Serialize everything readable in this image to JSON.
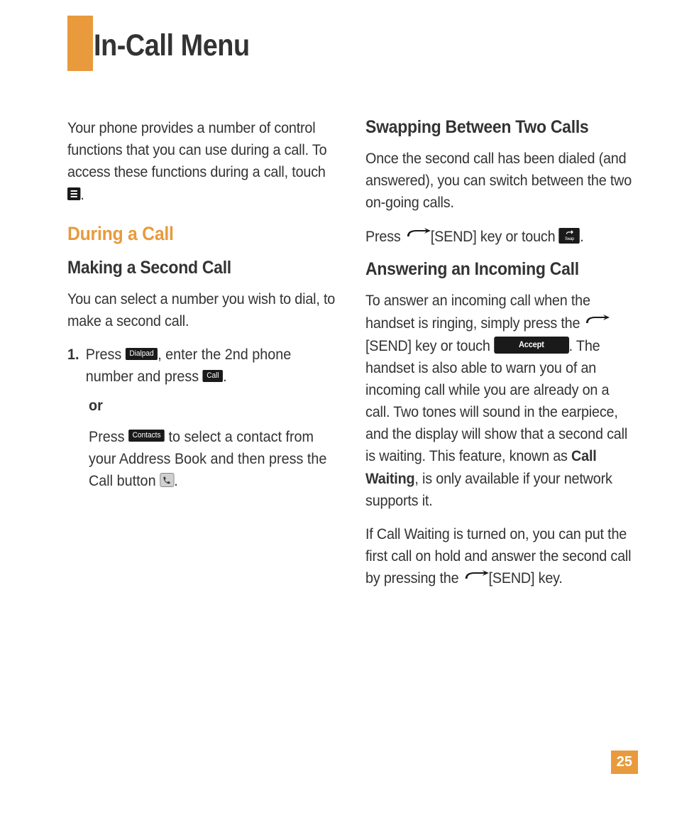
{
  "page": {
    "title": "In-Call Menu",
    "number": "25"
  },
  "col1": {
    "intro": "Your phone provides a number of control functions that you can use during a call. To access these functions during a call, touch ",
    "intro_after": ".",
    "section1": "During a Call",
    "sub1": "Making a Second Call",
    "sub1_p": "You can select a number you wish to dial, to make a second call.",
    "step_num": "1.",
    "step1a": "Press ",
    "step1b": ", enter the 2nd phone number and press ",
    "step1c": ".",
    "or": "or",
    "step2a": "Press ",
    "step2b": " to select a contact from your Address Book and then press the Call button ",
    "step2c": "."
  },
  "col2": {
    "sub2": "Swapping Between Two Calls",
    "sub2_p": "Once the second call has been dialed (and answered), you can switch between the two on-going calls.",
    "press_a": "Press ",
    "send_label": "[SEND] key or touch ",
    "press_c": ".",
    "sub3": "Answering an Incoming Call",
    "ans_a": "To answer an incoming call when the handset is ringing, simply press the ",
    "ans_b": "[SEND] key or touch ",
    "ans_c": ". The handset is also able to warn you of an incoming call while you are already on a call. Two tones will sound in the earpiece, and the display will show that a second call is waiting. This feature, known as ",
    "cw": "Call Waiting",
    "ans_d": ", is only available if your network supports it.",
    "cw2_a": "If Call Waiting is turned on, you can put the first call on hold and answer the second call by pressing the ",
    "cw2_b": "[SEND] key."
  },
  "buttons": {
    "dialpad": "Dialpad",
    "call": "Call",
    "contacts": "Contacts",
    "accept": "Accept",
    "swap": "Swap"
  }
}
